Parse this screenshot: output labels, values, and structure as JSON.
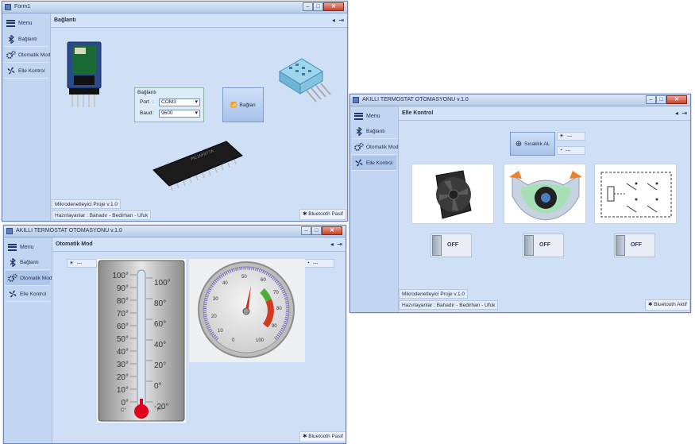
{
  "colors": {
    "window_bg": "#cfe0f6",
    "sidebar": "#c3d6f1",
    "accent": "#1f3566",
    "close": "#c8432a"
  },
  "win1": {
    "title": "Form1",
    "menu_label": "Menu",
    "nav": [
      "Bağlantı",
      "Otomatik Mod",
      "Elle Kontrol"
    ],
    "header_title": "Bağlantı",
    "conn_group": {
      "title": "Bağlantı",
      "port_label": "Port",
      "port_value": "COM3",
      "baud_label": "Baud",
      "baud_value": "9600"
    },
    "connect_button": "Bağlan",
    "project_label": "Mikrodenetleyici Proje v.1.0",
    "authors_label": "Hazırlayanlar : Bahadır - Bedirhan - Ufuk",
    "bt_status": "Bluetooth Pasif"
  },
  "win2": {
    "title": "AKILLI TERMOSTAT OTOMASYONU v.1.0",
    "menu_label": "Menu",
    "nav": [
      "Bağlantı",
      "Otomatik Mod",
      "Elle Kontrol"
    ],
    "header_title": "Otomatik Mod",
    "temp_value": "---",
    "humidity_value": "---",
    "thermo_c": [
      "100°",
      "90°",
      "80°",
      "70°",
      "60°",
      "50°",
      "40°",
      "30°",
      "20°",
      "10°",
      "0°"
    ],
    "thermo_f": [
      "100°",
      "80°",
      "60°",
      "40°",
      "20°",
      "0°",
      "-20°"
    ],
    "c_unit": "C°",
    "f_unit": "F°",
    "gauge_ticks": [
      "0",
      "10",
      "20",
      "30",
      "40",
      "50",
      "60",
      "70",
      "80",
      "90",
      "100"
    ],
    "bt_status": "Bluetooth Pasif"
  },
  "win3": {
    "title": "AKILLI TERMOSTAT OTOMASYONU v.1.0",
    "menu_label": "Menu",
    "nav": [
      "Bağlantı",
      "Otomatik Mod",
      "Elle Kontrol"
    ],
    "header_title": "Elle Kontrol",
    "read_temp_button": "Sıcaklık AL",
    "temp_value": "---",
    "humidity_value": "---",
    "toggles": [
      "OFF",
      "OFF",
      "OFF"
    ],
    "project_label": "Mikrodenetleyici Proje v.1.0",
    "authors_label": "Hazırlayanlar : Bahadır - Bedirhan - Ufuk",
    "bt_status": "Bluetooth Aktif"
  }
}
